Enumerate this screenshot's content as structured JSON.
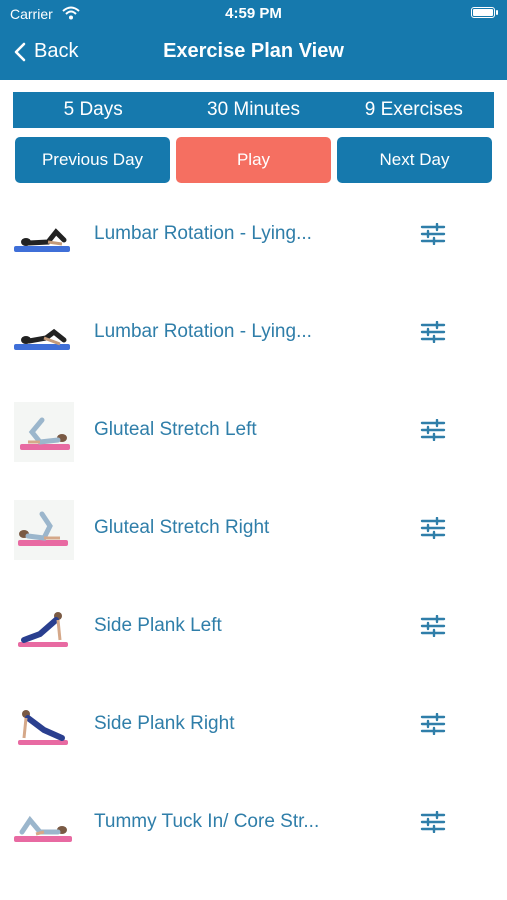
{
  "status_bar": {
    "carrier": "Carrier",
    "time": "4:59 PM"
  },
  "nav": {
    "back_label": "Back",
    "title": "Exercise Plan View"
  },
  "summary": {
    "days": "5 Days",
    "minutes": "30 Minutes",
    "exercises": "9 Exercises"
  },
  "buttons": {
    "previous": "Previous Day",
    "play": "Play",
    "next": "Next Day"
  },
  "exercises": [
    {
      "name": "Lumbar Rotation - Lying..."
    },
    {
      "name": "Lumbar Rotation - Lying..."
    },
    {
      "name": "Gluteal Stretch Left"
    },
    {
      "name": "Gluteal Stretch Right"
    },
    {
      "name": "Side Plank Left"
    },
    {
      "name": "Side Plank Right"
    },
    {
      "name": "Tummy Tuck In/ Core Str..."
    }
  ],
  "colors": {
    "primary": "#1679ad",
    "play": "#f56f61",
    "text_link": "#2f7ea9"
  }
}
